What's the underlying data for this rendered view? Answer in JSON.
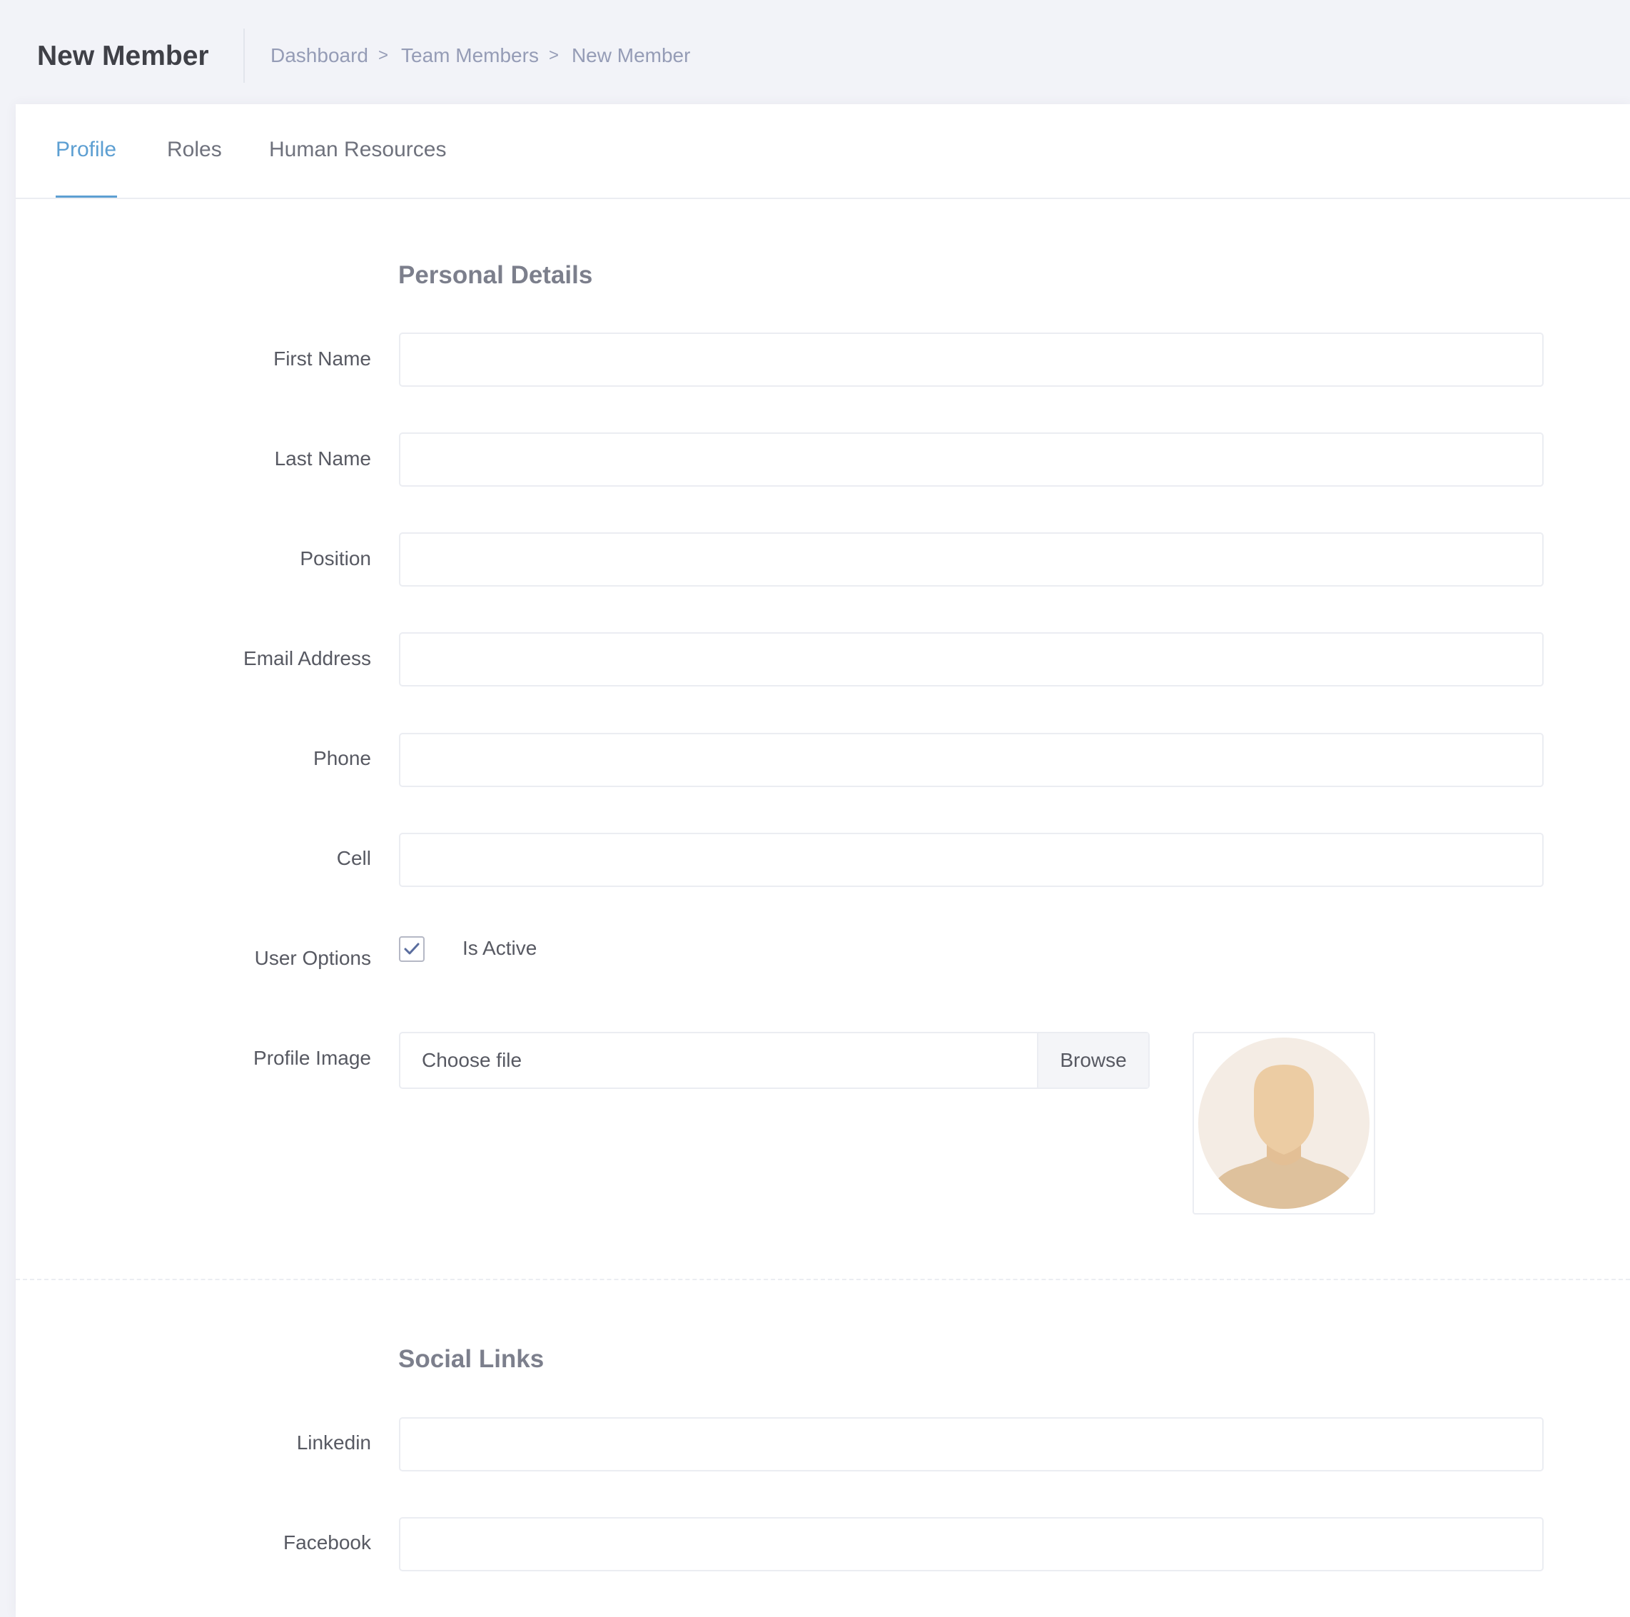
{
  "header": {
    "title": "New Member",
    "breadcrumbs": [
      "Dashboard",
      "Team Members",
      "New Member"
    ],
    "separator": ">"
  },
  "tabs": [
    {
      "label": "Profile",
      "active": true
    },
    {
      "label": "Roles",
      "active": false
    },
    {
      "label": "Human Resources",
      "active": false
    }
  ],
  "personal_details": {
    "title": "Personal Details",
    "fields": {
      "first_name": {
        "label": "First Name",
        "value": ""
      },
      "last_name": {
        "label": "Last Name",
        "value": ""
      },
      "position": {
        "label": "Position",
        "value": ""
      },
      "email": {
        "label": "Email Address",
        "value": ""
      },
      "phone": {
        "label": "Phone",
        "value": ""
      },
      "cell": {
        "label": "Cell",
        "value": ""
      }
    },
    "user_options": {
      "label": "User Options",
      "is_active_label": "Is Active",
      "is_active_checked": true
    },
    "profile_image": {
      "label": "Profile Image",
      "placeholder": "Choose file",
      "browse_label": "Browse",
      "avatar_icon": "default-avatar-icon"
    }
  },
  "social_links": {
    "title": "Social Links",
    "fields": {
      "linkedin": {
        "label": "Linkedin",
        "value": ""
      },
      "facebook": {
        "label": "Facebook",
        "value": ""
      }
    }
  },
  "colors": {
    "accent": "#5d9fd2",
    "page_background": "#f2f3f8",
    "card_background": "#ffffff",
    "border": "#ebedf2",
    "text": "#575962",
    "muted_text": "#959cb6"
  }
}
